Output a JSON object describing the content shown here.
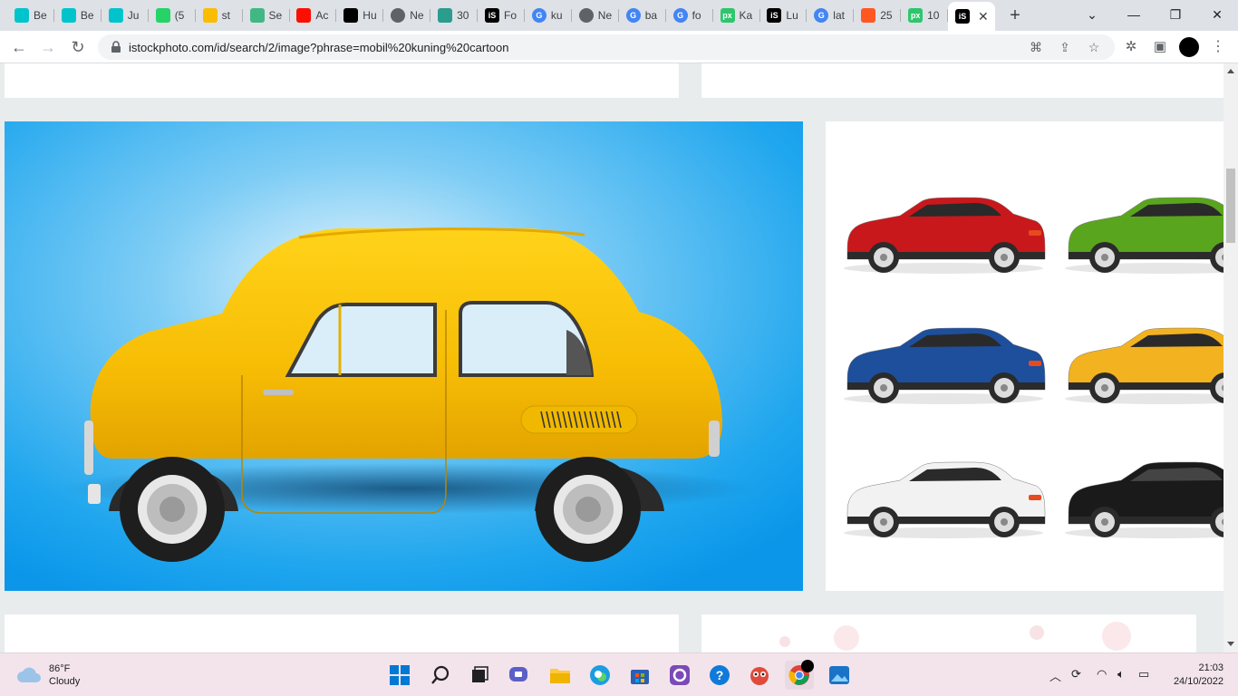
{
  "browser": {
    "tabs": [
      {
        "label": "Be",
        "icon": "canva-icon",
        "color": "#00c4cc"
      },
      {
        "label": "Be",
        "icon": "canva-icon",
        "color": "#00c4cc"
      },
      {
        "label": "Ju",
        "icon": "canva-icon",
        "color": "#00c4cc"
      },
      {
        "label": "(5",
        "icon": "whatsapp-icon",
        "color": "#25d366"
      },
      {
        "label": "st",
        "icon": "google-drive-icon",
        "color": "#fbbc04"
      },
      {
        "label": "Se",
        "icon": "vue-icon",
        "color": "#41b883"
      },
      {
        "label": "Ac",
        "icon": "adobe-icon",
        "color": "#fa0f00"
      },
      {
        "label": "Hu",
        "icon": "shutterstock-icon",
        "color": "#000000"
      },
      {
        "label": "Ne",
        "icon": "chrome-icon",
        "color": "#5f6368"
      },
      {
        "label": "30",
        "icon": "dreamstime-icon",
        "color": "#2a9d8f"
      },
      {
        "label": "Fo",
        "icon": "istock-icon",
        "color": "#000000"
      },
      {
        "label": "ku",
        "icon": "google-icon",
        "color": "#4285f4"
      },
      {
        "label": "Ne",
        "icon": "chrome-icon",
        "color": "#5f6368"
      },
      {
        "label": "ba",
        "icon": "google-icon",
        "color": "#4285f4"
      },
      {
        "label": "fo",
        "icon": "google-icon",
        "color": "#4285f4"
      },
      {
        "label": "Ka",
        "icon": "pixabay-icon",
        "color": "#2ec66d"
      },
      {
        "label": "Lu",
        "icon": "istock-icon",
        "color": "#000000"
      },
      {
        "label": "lat",
        "icon": "google-icon",
        "color": "#4285f4"
      },
      {
        "label": "25",
        "icon": "blogger-icon",
        "color": "#ff5722"
      },
      {
        "label": "10",
        "icon": "pixabay-icon",
        "color": "#2ec66d"
      }
    ],
    "active_tab_icon": "istock-icon",
    "url": "istockphoto.com/id/search/2/image?phrase=mobil%20kuning%20cartoon"
  },
  "gallery": {
    "main_image_alt": "yellow retro car on blue background",
    "side_image_alt": "six colored SUVs in a grid",
    "suv_colors": [
      "#c8181c",
      "#5aa51e",
      "#1d4f9c",
      "#f3b21f",
      "#f2f2f2",
      "#1a1a1a"
    ]
  },
  "taskbar": {
    "weather_temp": "86°F",
    "weather_desc": "Cloudy",
    "time": "21:03",
    "date": "24/10/2022"
  }
}
